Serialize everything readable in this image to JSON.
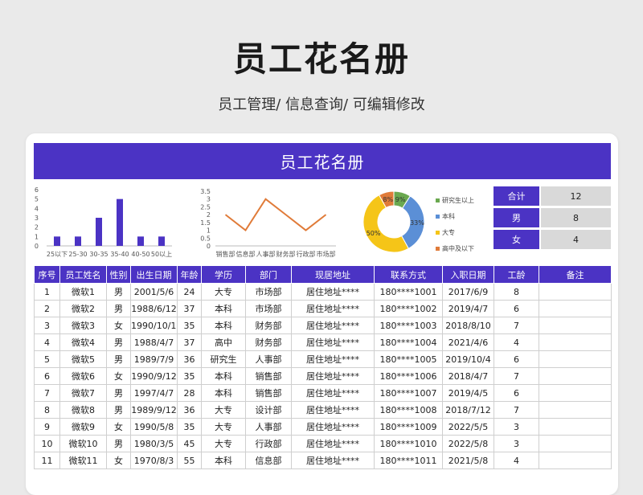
{
  "page": {
    "title": "员工花名册",
    "subtitle": "员工管理/ 信息查询/ 可编辑修改"
  },
  "sheet": {
    "header": "员工花名册"
  },
  "colors": {
    "accent": "#4b33c4",
    "line": "#e07b39"
  },
  "stats": [
    {
      "label": "合计",
      "value": "12"
    },
    {
      "label": "男",
      "value": "8"
    },
    {
      "label": "女",
      "value": "4"
    }
  ],
  "chart_data": [
    {
      "type": "bar",
      "categories": [
        "25以下",
        "25-30",
        "30-35",
        "35-40",
        "40-50",
        "50以上"
      ],
      "values": [
        1,
        1,
        3,
        5,
        1,
        1
      ],
      "ylim": [
        0,
        6
      ],
      "yticks": [
        "0",
        "1",
        "2",
        "3",
        "4",
        "5",
        "6"
      ],
      "color": "#4b33c4"
    },
    {
      "type": "line",
      "categories": [
        "销售部",
        "信息部",
        "人事部",
        "财务部",
        "行政部",
        "市场部"
      ],
      "values": [
        2,
        1,
        3,
        2,
        1,
        2
      ],
      "ylim": [
        0,
        3.5
      ],
      "yticks": [
        "0",
        "0.5",
        "1",
        "1.5",
        "2",
        "2.5",
        "3",
        "3.5"
      ],
      "color": "#e07b39"
    },
    {
      "type": "pie",
      "categories": [
        "研究生以上",
        "本科",
        "大专",
        "高中及以下"
      ],
      "values": [
        9,
        33,
        50,
        8
      ],
      "labels": [
        "9%",
        "33%",
        "50%",
        "8%"
      ],
      "colors": [
        "#6aa84f",
        "#5b8fd6",
        "#f5c518",
        "#e07b39"
      ],
      "legend": "right"
    }
  ],
  "table": {
    "columns": [
      "序号",
      "员工姓名",
      "性别",
      "出生日期",
      "年龄",
      "学历",
      "部门",
      "现居地址",
      "联系方式",
      "入职日期",
      "工龄",
      "备注"
    ],
    "rows": [
      [
        "1",
        "微软1",
        "男",
        "2001/5/6",
        "24",
        "大专",
        "市场部",
        "居住地址****",
        "180****1001",
        "2017/6/9",
        "8",
        ""
      ],
      [
        "2",
        "微软2",
        "男",
        "1988/6/12",
        "37",
        "本科",
        "市场部",
        "居住地址****",
        "180****1002",
        "2019/4/7",
        "6",
        ""
      ],
      [
        "3",
        "微软3",
        "女",
        "1990/10/11",
        "35",
        "本科",
        "财务部",
        "居住地址****",
        "180****1003",
        "2018/8/10",
        "7",
        ""
      ],
      [
        "4",
        "微软4",
        "男",
        "1988/4/7",
        "37",
        "高中",
        "财务部",
        "居住地址****",
        "180****1004",
        "2021/4/6",
        "4",
        ""
      ],
      [
        "5",
        "微软5",
        "男",
        "1989/7/9",
        "36",
        "研究生",
        "人事部",
        "居住地址****",
        "180****1005",
        "2019/10/4",
        "6",
        ""
      ],
      [
        "6",
        "微软6",
        "女",
        "1990/9/12",
        "35",
        "本科",
        "销售部",
        "居住地址****",
        "180****1006",
        "2018/4/7",
        "7",
        ""
      ],
      [
        "7",
        "微软7",
        "男",
        "1997/4/7",
        "28",
        "本科",
        "销售部",
        "居住地址****",
        "180****1007",
        "2019/4/5",
        "6",
        ""
      ],
      [
        "8",
        "微软8",
        "男",
        "1989/9/12",
        "36",
        "大专",
        "设计部",
        "居住地址****",
        "180****1008",
        "2018/7/12",
        "7",
        ""
      ],
      [
        "9",
        "微软9",
        "女",
        "1990/5/8",
        "35",
        "大专",
        "人事部",
        "居住地址****",
        "180****1009",
        "2022/5/5",
        "3",
        ""
      ],
      [
        "10",
        "微软10",
        "男",
        "1980/3/5",
        "45",
        "大专",
        "行政部",
        "居住地址****",
        "180****1010",
        "2022/5/8",
        "3",
        ""
      ],
      [
        "11",
        "微软11",
        "女",
        "1970/8/3",
        "55",
        "本科",
        "信息部",
        "居住地址****",
        "180****1011",
        "2021/5/8",
        "4",
        ""
      ]
    ]
  }
}
